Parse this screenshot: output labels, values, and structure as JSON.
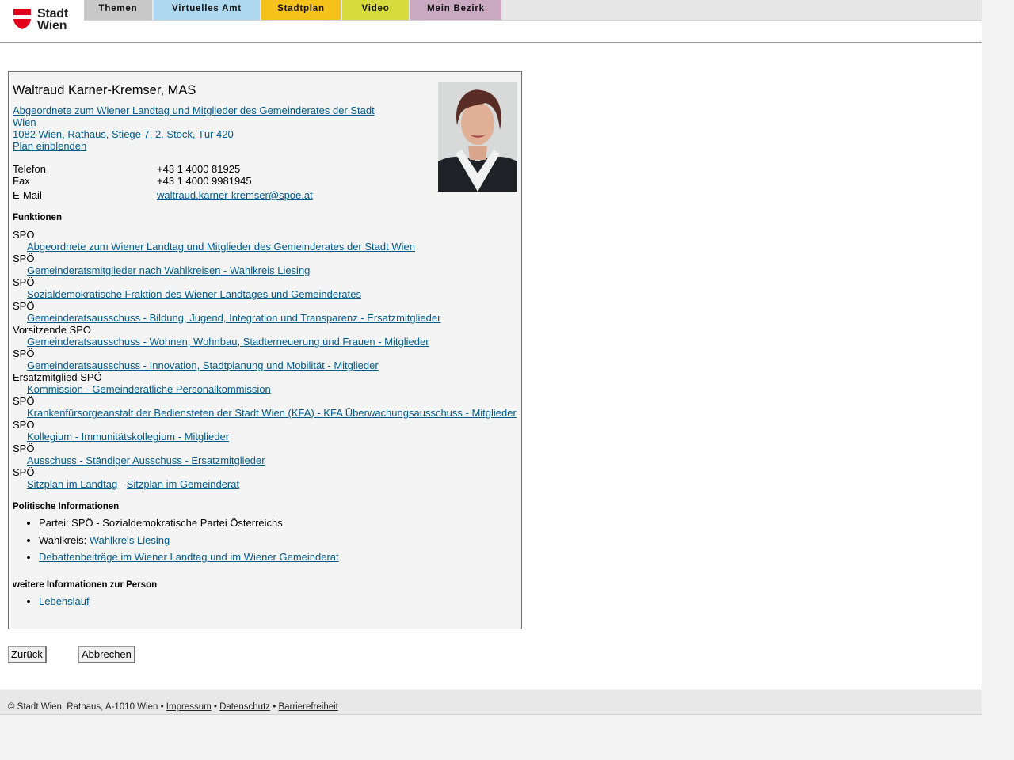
{
  "header": {
    "logo_text_line1": "Stadt",
    "logo_text_line2": "Wien",
    "nav": [
      {
        "label": "Themen",
        "color": "#c8c8c8"
      },
      {
        "label": "Virtuelles Amt",
        "color": "#aed8ef"
      },
      {
        "label": "Stadtplan",
        "color": "#f5c11b"
      },
      {
        "label": "Video",
        "color": "#d6dc3e"
      },
      {
        "label": "Mein Bezirk",
        "color": "#c9a8c2"
      }
    ]
  },
  "person": {
    "name": "Waltraud Karner-Kremser, MAS",
    "role_link_line1": "Abgeordnete zum Wiener Landtag und Mitglieder des Gemeinderates der Stadt",
    "role_link_line2": "Wien",
    "address": "1082 Wien, Rathaus, Stiege 7, 2. Stock, Tür 420",
    "plan_link": "Plan einblenden",
    "contact": [
      {
        "label": "Telefon",
        "value": "+43 1 4000 81925",
        "link": false
      },
      {
        "label": "Fax",
        "value": "+43 1 4000 9981945",
        "link": false
      },
      {
        "label": "E-Mail",
        "value": "waltraud.karner-kremser@spoe.at",
        "link": true
      }
    ]
  },
  "functions_title": "Funktionen",
  "functions": [
    {
      "role": "SPÖ",
      "link": "Abgeordnete zum Wiener Landtag und Mitglieder des Gemeinderates der Stadt Wien"
    },
    {
      "role": "SPÖ",
      "link": "Gemeinderatsmitglieder nach Wahlkreisen - Wahlkreis Liesing"
    },
    {
      "role": "SPÖ",
      "link": "Sozialdemokratische Fraktion des Wiener Landtages und Gemeinderates"
    },
    {
      "role": "SPÖ",
      "link": "Gemeinderatsausschuss - Bildung, Jugend, Integration und Transparenz - Ersatzmitglieder"
    },
    {
      "role": "Vorsitzende SPÖ",
      "link": "Gemeinderatsausschuss - Wohnen, Wohnbau, Stadterneuerung und Frauen - Mitglieder"
    },
    {
      "role": "SPÖ",
      "link": "Gemeinderatsausschuss - Innovation, Stadtplanung und Mobilität - Mitglieder"
    },
    {
      "role": "Ersatzmitglied SPÖ",
      "link": "Kommission - Gemeinderätliche Personalkommission"
    },
    {
      "role": "SPÖ",
      "link": "Krankenfürsorgeanstalt der Bediensteten der Stadt Wien (KFA) - KFA Überwachungsausschuss - Mitglieder"
    },
    {
      "role": "SPÖ",
      "link": "Kollegium - Immunitätskollegium - Mitglieder"
    },
    {
      "role": "SPÖ",
      "link": "Ausschuss - Ständiger Ausschuss - Ersatzmitglieder"
    }
  ],
  "seating": {
    "role": "SPÖ",
    "link1": "Sitzplan im Landtag",
    "separator": " - ",
    "link2": "Sitzplan im Gemeinderat"
  },
  "political_title": "Politische Informationen",
  "political": {
    "party": "Partei: SPÖ - Sozialdemokratische Partei Österreichs",
    "wahlkreis_label": "Wahlkreis: ",
    "wahlkreis_link": "Wahlkreis Liesing",
    "debates_link": "Debattenbeiträge im Wiener Landtag und im Wiener Gemeinderat"
  },
  "more_title": "weitere Informationen zur Person",
  "more": {
    "cv_link": "Lebenslauf"
  },
  "buttons": {
    "back": "Zurück",
    "cancel": "Abbrechen"
  },
  "footer": {
    "copyright": "© Stadt Wien, Rathaus, A-1010 Wien • ",
    "impressum": "Impressum",
    "sep1": " • ",
    "datenschutz": "Datenschutz",
    "sep2": " • ",
    "barrierefreiheit": "Barrierefreiheit"
  }
}
